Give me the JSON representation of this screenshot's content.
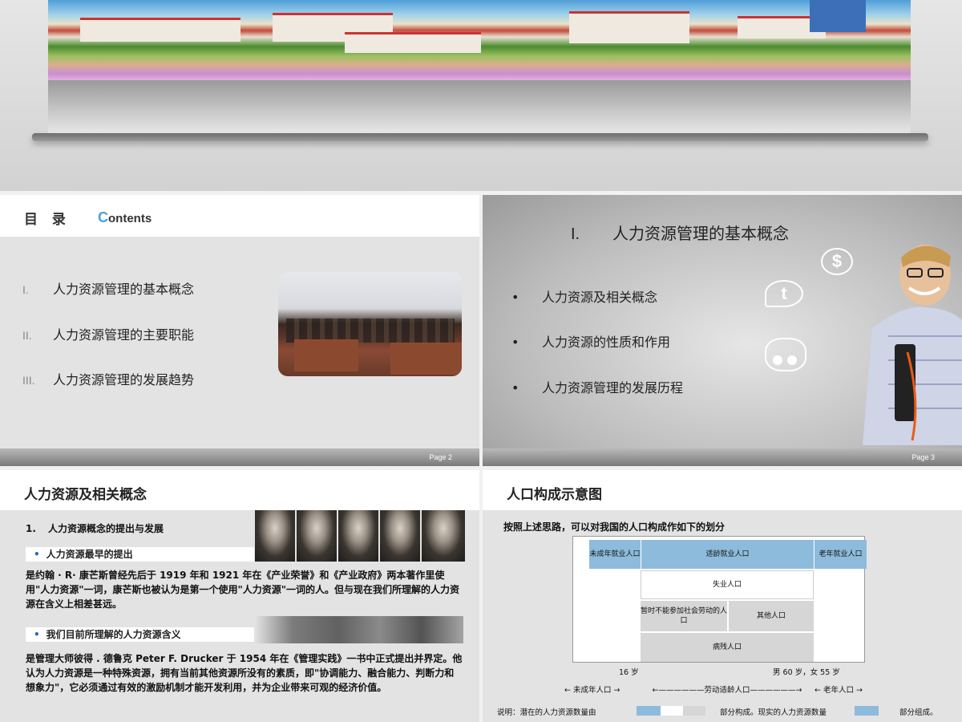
{
  "slide2": {
    "title_cn": "目 录",
    "title_en_initial": "C",
    "title_en_rest": "ontents",
    "toc": [
      {
        "num": "I.",
        "label": "人力资源管理的基本概念"
      },
      {
        "num": "II.",
        "label": "人力资源管理的主要职能"
      },
      {
        "num": "III.",
        "label": "人力资源管理的发展趋势"
      }
    ],
    "page": "Page 2"
  },
  "slide3": {
    "roman": "I.",
    "heading": "人力资源管理的基本概念",
    "bullets": [
      "人力资源及相关概念",
      "人力资源的性质和作用",
      "人力资源管理的发展历程"
    ],
    "bullet_glyph": "•",
    "icon_dollar": "$",
    "icon_t": "t",
    "page": "Page 3"
  },
  "slide4": {
    "title": "人力资源及相关概念",
    "sub_num": "1.",
    "sub_title": "人力资源概念的提出与发展",
    "bar1": "人力资源最早的提出",
    "para1": "是约翰 · R· 康芒斯曾经先后于 1919 年和 1921 年在《产业荣誉》和《产业政府》两本著作里使用\"人力资源\"一词，康芒斯也被认为是第一个使用\"人力资源\"一词的人。但与现在我们所理解的人力资源在含义上相差甚远。",
    "bar2": "我们目前所理解的人力资源含义",
    "para2": "是管理大师彼得 . 德鲁克 Peter F. Drucker 于 1954 年在《管理实践》一书中正式提出并界定。他认为人力资源是一种特殊资源，拥有当前其他资源所没有的素质，即\"协调能力、融合能力、判断力和想象力\"，它必须通过有效的激励机制才能开发利用，并为企业带来可观的经济价值。",
    "bullet_glyph": "•"
  },
  "slide5": {
    "title": "人口构成示意图",
    "intro": "按照上述思路，可以对我国的人口构成作如下的划分",
    "cells": {
      "minor_work": "未成年就业人口",
      "working_age_work": "适龄就业人口",
      "elder_work": "老年就业人口",
      "unemployed": "失业人口",
      "temp_unable": "暂时不能参加社会劳动的人口",
      "other": "其他人口",
      "disabled": "病残人口"
    },
    "age16": "16 岁",
    "age60": "男 60 岁，女 55 岁",
    "arrows": {
      "minor": "未成年人口",
      "working": "劳动适龄人口",
      "elder": "老年人口"
    },
    "note_a": "说明：潜在的人力资源数量由",
    "note_b": "部分构成。现实的人力资源数量",
    "note_c": "部分组成。",
    "colors": {
      "blue": "#8dbbdc",
      "grey": "#d6d6d6",
      "white": "#ffffff"
    }
  }
}
